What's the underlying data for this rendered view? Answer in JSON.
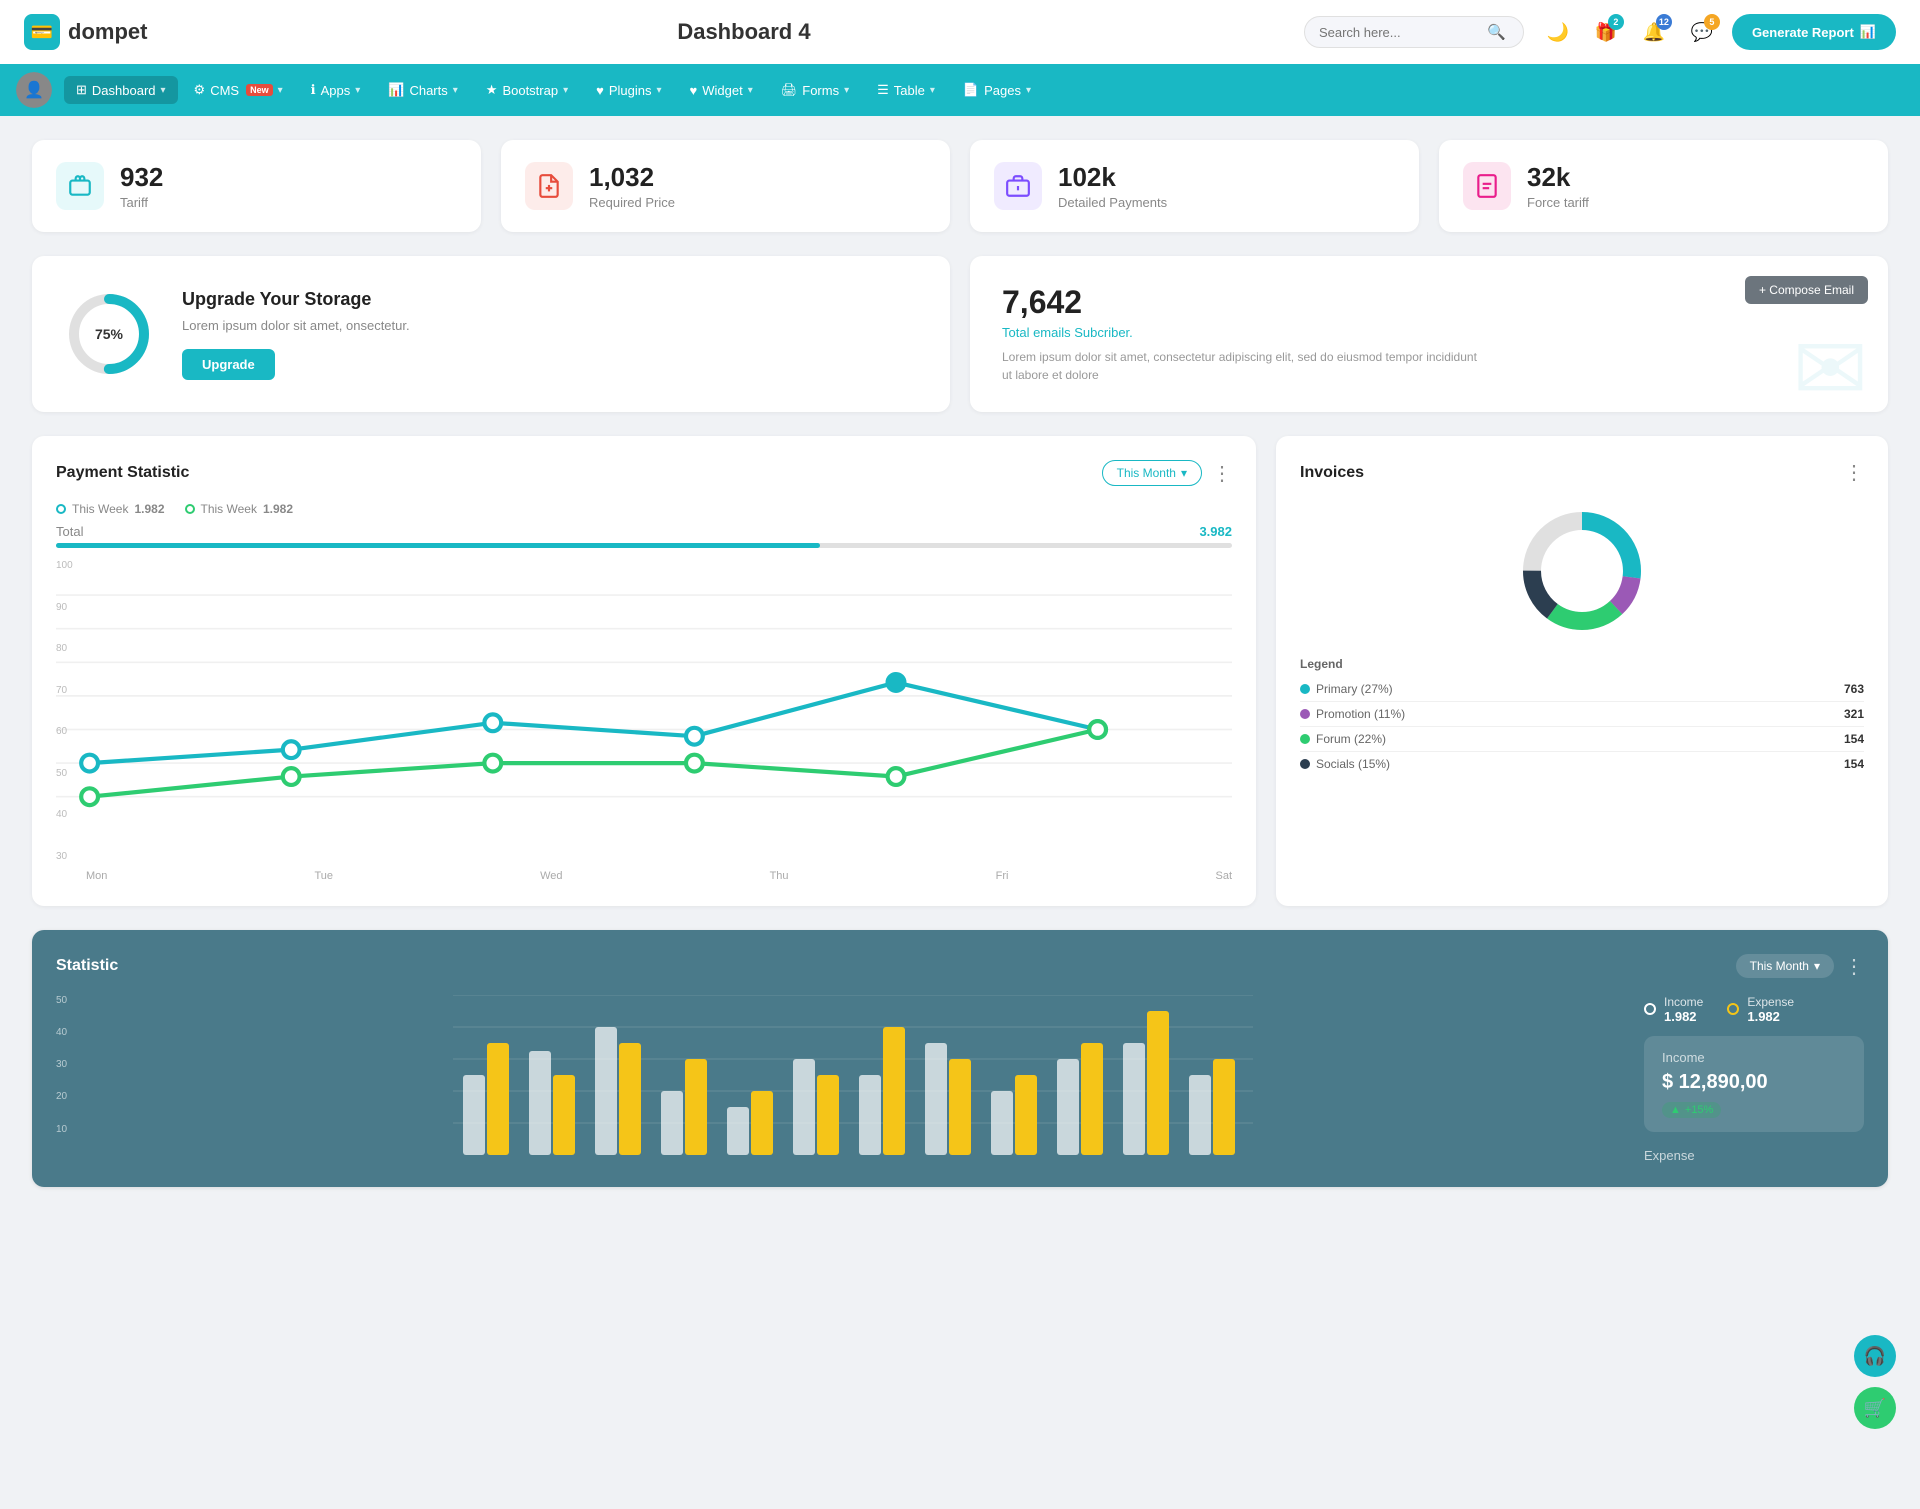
{
  "header": {
    "logo_icon": "💳",
    "logo_text": "dompet",
    "page_title": "Dashboard 4",
    "search_placeholder": "Search here...",
    "generate_report_label": "Generate Report",
    "icons": {
      "moon": "🌙",
      "gift": "🎁",
      "bell": "🔔",
      "chat": "💬"
    },
    "badges": {
      "gift": "2",
      "bell": "12",
      "chat": "5"
    }
  },
  "nav": {
    "items": [
      {
        "label": "Dashboard",
        "icon": "⊞",
        "active": true,
        "has_arrow": true
      },
      {
        "label": "CMS",
        "icon": "⚙",
        "has_arrow": true,
        "is_new": true
      },
      {
        "label": "Apps",
        "icon": "ℹ",
        "has_arrow": true
      },
      {
        "label": "Charts",
        "icon": "📊",
        "has_arrow": true
      },
      {
        "label": "Bootstrap",
        "icon": "★",
        "has_arrow": true
      },
      {
        "label": "Plugins",
        "icon": "♥",
        "has_arrow": true
      },
      {
        "label": "Widget",
        "icon": "♥",
        "has_arrow": true
      },
      {
        "label": "Forms",
        "icon": "🖨",
        "has_arrow": true
      },
      {
        "label": "Table",
        "icon": "☰",
        "has_arrow": true
      },
      {
        "label": "Pages",
        "icon": "📄",
        "has_arrow": true
      }
    ]
  },
  "stat_cards": [
    {
      "value": "932",
      "label": "Tariff",
      "icon_type": "teal"
    },
    {
      "value": "1,032",
      "label": "Required Price",
      "icon_type": "red"
    },
    {
      "value": "102k",
      "label": "Detailed Payments",
      "icon_type": "purple"
    },
    {
      "value": "32k",
      "label": "Force tariff",
      "icon_type": "pink"
    }
  ],
  "storage": {
    "percent": "75%",
    "title": "Upgrade Your Storage",
    "description": "Lorem ipsum dolor sit amet, onsectetur.",
    "btn_label": "Upgrade",
    "percent_num": 75
  },
  "email": {
    "count": "7,642",
    "sub_label": "Total emails Subcriber.",
    "description": "Lorem ipsum dolor sit amet, consectetur adipiscing elit, sed do eiusmod tempor incididunt ut labore et dolore",
    "compose_btn": "+ Compose Email"
  },
  "payment": {
    "title": "Payment Statistic",
    "filter": "This Month",
    "legend": [
      {
        "label": "This Week",
        "value": "1.982",
        "dot": "teal"
      },
      {
        "label": "This Week",
        "value": "1.982",
        "dot": "green"
      }
    ],
    "total_label": "Total",
    "total_value": "3.982",
    "progress": 65,
    "x_labels": [
      "Mon",
      "Tue",
      "Wed",
      "Thu",
      "Fri",
      "Sat"
    ],
    "y_labels": [
      "100",
      "90",
      "80",
      "70",
      "60",
      "50",
      "40",
      "30"
    ]
  },
  "invoices": {
    "title": "Invoices",
    "legend": [
      {
        "label": "Primary (27%)",
        "value": "763",
        "color": "#19b8c4"
      },
      {
        "label": "Promotion (11%)",
        "value": "321",
        "color": "#9b59b6"
      },
      {
        "label": "Forum (22%)",
        "value": "154",
        "color": "#2ecc71"
      },
      {
        "label": "Socials (15%)",
        "value": "154",
        "color": "#2c3e50"
      }
    ]
  },
  "statistic": {
    "title": "Statistic",
    "filter": "This Month",
    "y_labels": [
      "50",
      "40",
      "30",
      "20",
      "10"
    ],
    "income_label": "Income",
    "income_value": "1.982",
    "expense_label": "Expense",
    "expense_value": "1.982",
    "income_box": {
      "title": "Income",
      "amount": "$ 12,890,00",
      "badge": "+15%"
    },
    "expense_box_label": "Expense"
  },
  "float_btns": {
    "headset_icon": "🎧",
    "cart_icon": "🛒"
  }
}
